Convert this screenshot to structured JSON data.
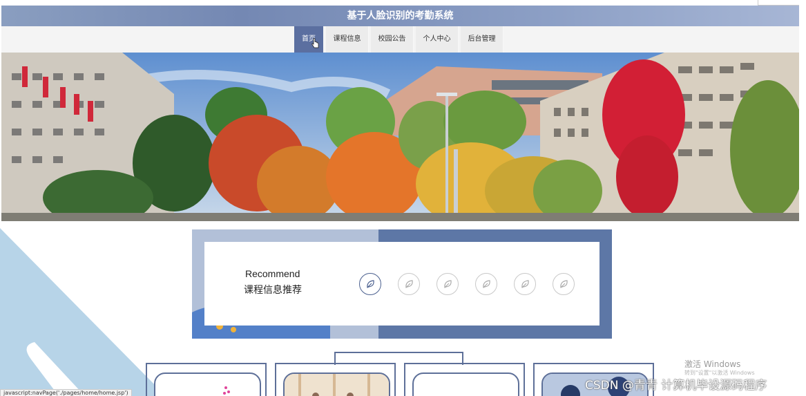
{
  "header": {
    "title": "基于人脸识别的考勤系统"
  },
  "nav": {
    "items": [
      {
        "label": "首页",
        "active": true
      },
      {
        "label": "课程信息"
      },
      {
        "label": "校园公告"
      },
      {
        "label": "个人中心"
      },
      {
        "label": "后台管理"
      }
    ]
  },
  "recommend": {
    "title_en": "Recommend",
    "title_cn": "课程信息推荐",
    "icon": "leaf-icon"
  },
  "overlay": {
    "activate_windows": "激活 Windows",
    "activate_hint": "转到\"设置\"以激活 Windows",
    "csdn": "CSDN @青青  计算机毕设源码程序"
  },
  "status": {
    "link": "javascript:navPage('./pages/home/home.jsp')"
  },
  "colors": {
    "accent": "#5b6fa0",
    "panel": "#5d77a6",
    "light_panel": "#b2c0d8"
  }
}
